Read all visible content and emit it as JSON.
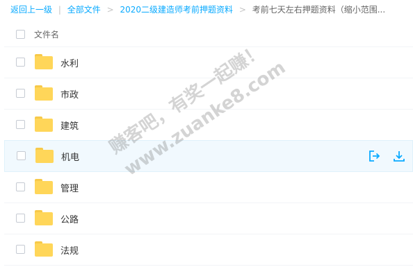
{
  "breadcrumb": {
    "back": "返回上一级",
    "divider": "|",
    "all_files": "全部文件",
    "folder": "2020二级建造师考前押题资料",
    "current": "考前七天左右押题资料（缩小范围..."
  },
  "header": {
    "label": "文件名"
  },
  "rows": [
    {
      "name": "水利"
    },
    {
      "name": "市政"
    },
    {
      "name": "建筑"
    },
    {
      "name": "机电"
    },
    {
      "name": "管理"
    },
    {
      "name": "公路"
    },
    {
      "name": "法规"
    }
  ],
  "watermark": {
    "line1": "赚客吧，有奖一起赚！",
    "line2": "www.zuanke8.com"
  },
  "colors": {
    "link": "#09aaff",
    "folder": "#ffd659",
    "hover_bg": "#f1f9fe",
    "icon_accent": "#09aaff"
  }
}
